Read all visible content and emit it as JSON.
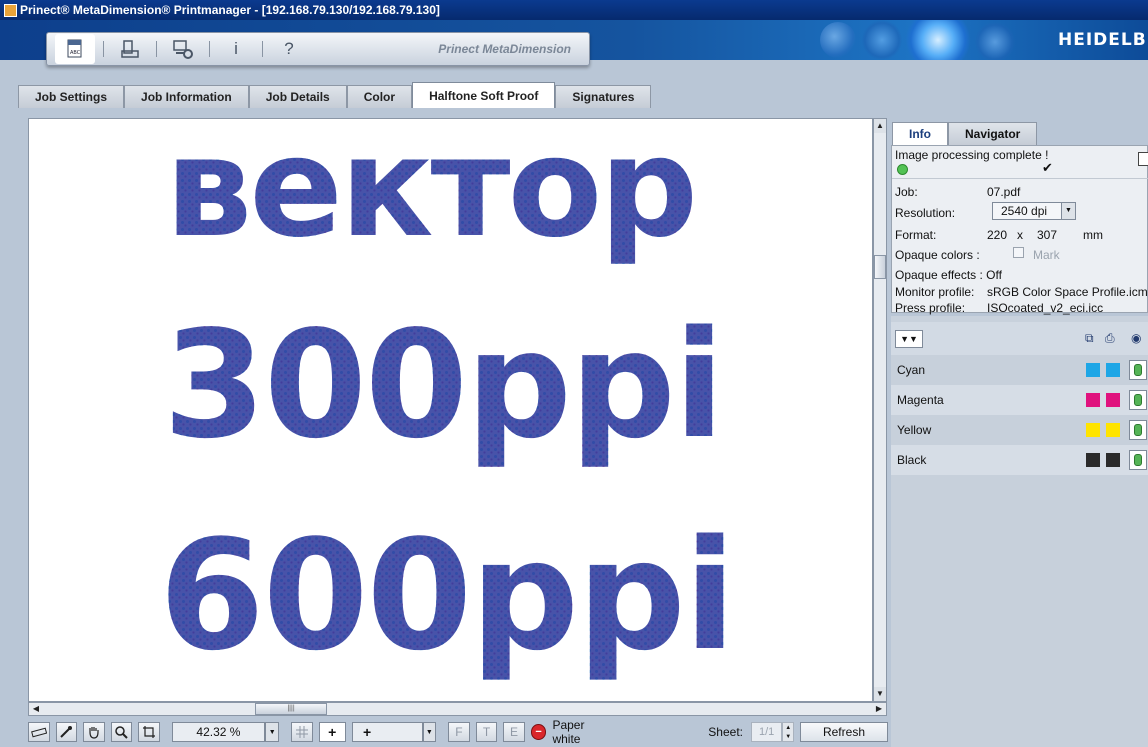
{
  "window": {
    "title": "Prinect® MetaDimension® Printmanager - [192.168.79.130/192.168.79.130]",
    "brand": "HEIDELBE"
  },
  "toolbar": {
    "brand": "Prinect MetaDimension",
    "info_glyph": "i",
    "help_glyph": "?"
  },
  "tabs": [
    "Job Settings",
    "Job Information",
    "Job Details",
    "Color",
    "Halftone Soft Proof",
    "Signatures"
  ],
  "active_tab": "Halftone Soft Proof",
  "proof": {
    "line1": "вектор",
    "line2": "300ppi",
    "line3": "600ppi"
  },
  "bottombar": {
    "zoom": "42.32 %",
    "plus": "+",
    "plus_select": "+",
    "paper_white_label": "Paper white",
    "sheet_label": "Sheet:",
    "sheet_value": "1/1",
    "refresh_label": "Refresh",
    "f1": "F",
    "f2": "Т",
    "f3": "E"
  },
  "right_tabs": [
    "Info",
    "Navigator"
  ],
  "info": {
    "status": "Image processing complete !",
    "check": "✔",
    "job_label": "Job:",
    "job_value": "07.pdf",
    "resolution_label": "Resolution:",
    "resolution_value": "2540 dpi",
    "format_label": "Format:",
    "format_w": "220",
    "format_x": "x",
    "format_h": "307",
    "format_unit": "mm",
    "opaque_colors_label": "Opaque colors :",
    "mark_label": "Mark",
    "opaque_effects_label": "Opaque effects : Off",
    "monitor_profile_label": "Monitor profile:",
    "monitor_profile_value": "sRGB Color Space Profile.icm",
    "press_profile_label": "Press profile:",
    "press_profile_value": "ISOcoated_v2_eci.icc"
  },
  "separations": [
    {
      "name": "Cyan",
      "color": "#1ea6e6"
    },
    {
      "name": "Magenta",
      "color": "#e0127e"
    },
    {
      "name": "Yellow",
      "color": "#ffe400"
    },
    {
      "name": "Black",
      "color": "#2a2a2a"
    }
  ],
  "colors": {
    "title_bar": "#0b3a8f",
    "accent": "#1b3e7d",
    "status_ok": "#52c254",
    "stop": "#d9262b"
  }
}
